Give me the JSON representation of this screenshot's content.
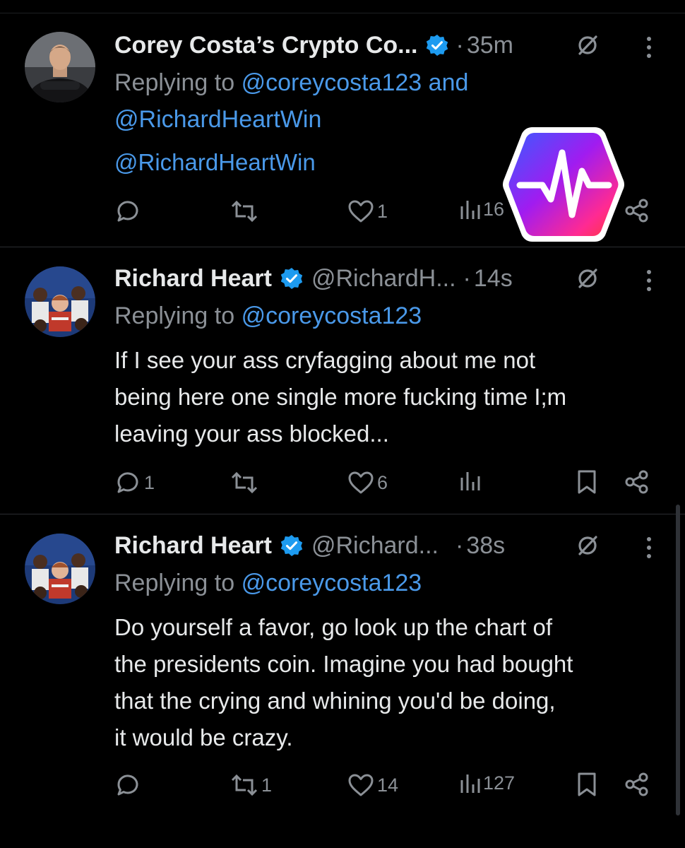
{
  "colors": {
    "background": "#000000",
    "text": "#e7e9ea",
    "muted": "#8b9096",
    "link": "#4a99e9",
    "verified": "#1d9bf0"
  },
  "tweets": [
    {
      "author_name": "Corey Costa’s Crypto Co...",
      "handle": "",
      "time": "35m",
      "verified": true,
      "replying_label": "Replying to",
      "replying_to_1": "@coreycosta123",
      "replying_and": "and",
      "replying_to_2": "@RichardHeartWin",
      "body": [
        "@RichardHeartWin"
      ],
      "actions": {
        "replies": "",
        "reposts": "",
        "likes": "1",
        "views": "16"
      }
    },
    {
      "author_name": "Richard Heart",
      "handle": "@RichardH...",
      "time": "14s",
      "verified": true,
      "replying_label": "Replying to",
      "replying_to_1": "@coreycosta123",
      "body": [
        "If I see your ass cryfagging about me not",
        "being here one single more fucking time I;m",
        "leaving your ass blocked..."
      ],
      "actions": {
        "replies": "1",
        "reposts": "",
        "likes": "6",
        "views": ""
      }
    },
    {
      "author_name": "Richard Heart",
      "handle": "@Richard...",
      "time": "38s",
      "verified": true,
      "replying_label": "Replying to",
      "replying_to_1": "@coreycosta123",
      "body": [
        "Do yourself a favor, go look up the chart of",
        "the presidents coin. Imagine you had bought",
        "that the crying and whining you'd be doing,",
        "it would be crazy."
      ],
      "actions": {
        "replies": "",
        "reposts": "1",
        "likes": "14",
        "views": "127"
      }
    }
  ],
  "overlay": {
    "icon": "pulse-logo-icon"
  }
}
